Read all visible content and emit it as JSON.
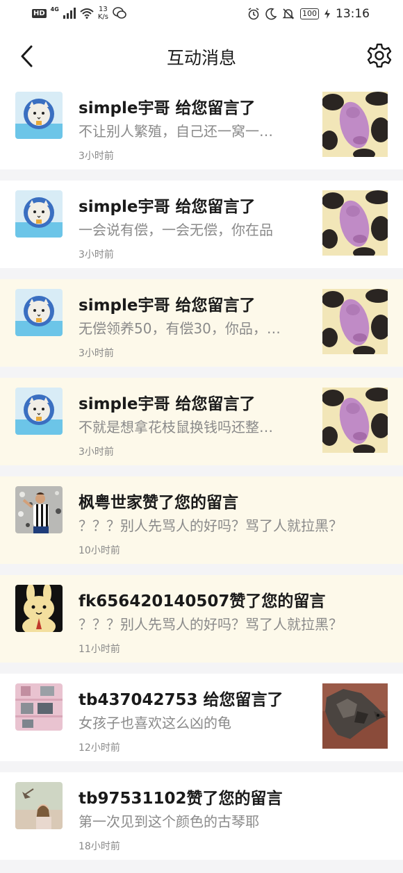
{
  "status_bar": {
    "hd": "HD",
    "net": "4G",
    "speed_value": "13",
    "speed_unit": "K/s",
    "battery": "100",
    "time": "13:16"
  },
  "header": {
    "title": "互动消息"
  },
  "messages": [
    {
      "title": "simple宇哥 给您留言了",
      "preview": "不让别人繁殖，自己还一窝一…",
      "time": "3小时前",
      "avatar": "cat-astronaut-avatar",
      "thumb": "pink-toy-thumbnail"
    },
    {
      "title": "simple宇哥 给您留言了",
      "preview": "一会说有偿，一会无偿，你在品",
      "time": "3小时前",
      "avatar": "cat-astronaut-avatar",
      "thumb": "pink-toy-thumbnail"
    },
    {
      "title": "simple宇哥 给您留言了",
      "preview": "无偿领养50，有偿30，你品，…",
      "time": "3小时前",
      "avatar": "cat-astronaut-avatar",
      "thumb": "pink-toy-thumbnail"
    },
    {
      "title": "simple宇哥 给您留言了",
      "preview": "不就是想拿花枝鼠换钱吗还整…",
      "time": "3小时前",
      "avatar": "cat-astronaut-avatar",
      "thumb": "pink-toy-thumbnail"
    },
    {
      "title": "枫粤世家赞了您的留言",
      "preview": "？？？别人先骂人的好吗？骂了人就拉黑？",
      "time": "10小时前",
      "avatar": "soccer-player-avatar"
    },
    {
      "title": "fk656420140507赞了您的留言",
      "preview": "？？？别人先骂人的好吗？骂了人就拉黑？",
      "time": "11小时前",
      "avatar": "cartoon-rabbit-avatar"
    },
    {
      "title": "tb437042753 给您留言了",
      "preview": "女孩子也喜欢这么凶的龟",
      "time": "12小时前",
      "avatar": "pink-building-avatar",
      "thumb": "turtle-thumbnail"
    },
    {
      "title": "tb97531102赞了您的留言",
      "preview": "第一次见到这个颜色的古琴耶",
      "time": "18小时前",
      "avatar": "girl-bird-avatar"
    }
  ],
  "colors": {
    "highlight_bg": "#fdf9ea",
    "card_bg": "#ffffff",
    "page_bg": "#f4f4f6",
    "secondary_text": "#8a8a8a"
  }
}
